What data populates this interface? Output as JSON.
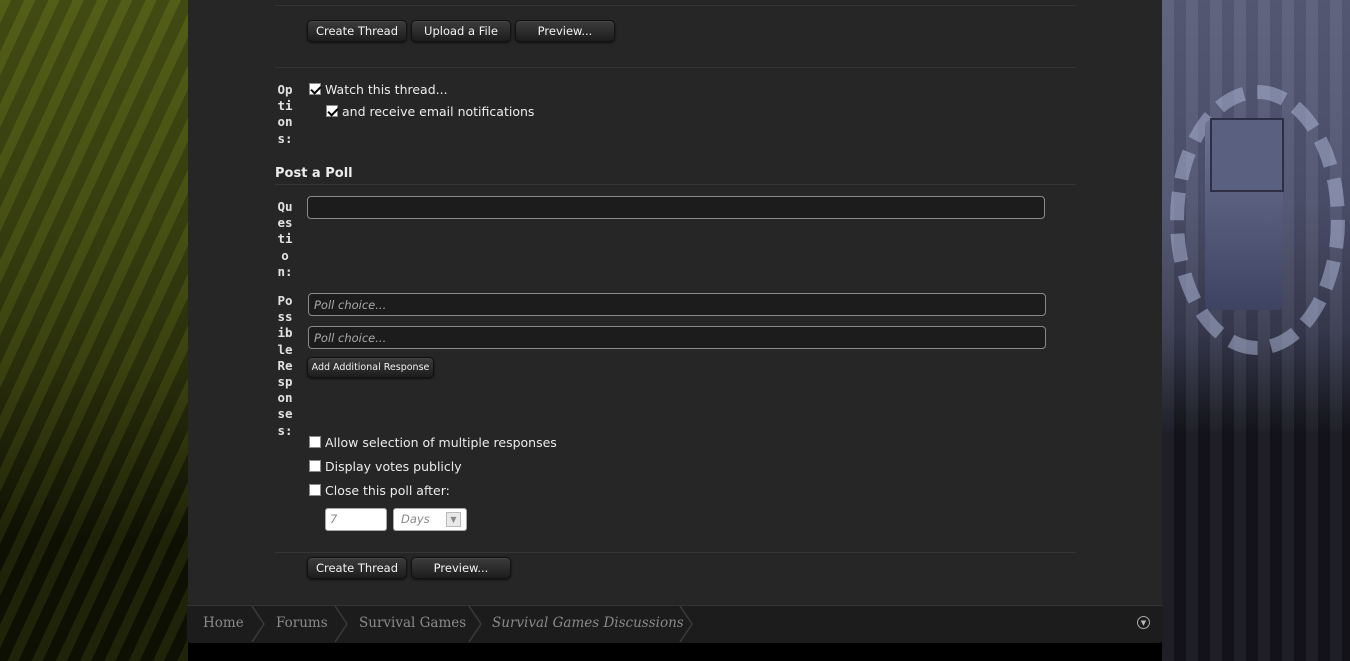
{
  "top_buttons": {
    "create_thread": "Create Thread",
    "upload_file": "Upload a File",
    "preview": "Preview..."
  },
  "options": {
    "label": "Options:",
    "watch_thread": "Watch this thread...",
    "receive_email": "and receive email notifications"
  },
  "poll": {
    "title": "Post a Poll",
    "question_label": "Question:",
    "question_value": "",
    "responses_label": "Possible Responses:",
    "choice_placeholder_1": "Poll choice...",
    "choice_placeholder_2": "Poll choice...",
    "add_response": "Add Additional Response",
    "allow_multiple": "Allow selection of multiple responses",
    "display_votes": "Display votes publicly",
    "close_after": "Close this poll after:",
    "close_value": "7",
    "close_unit": "Days"
  },
  "bottom_buttons": {
    "create_thread": "Create Thread",
    "preview": "Preview..."
  },
  "breadcrumb": {
    "items": [
      "Home",
      "Forums",
      "Survival Games",
      "Survival Games Discussions"
    ]
  },
  "colors": {
    "panel": "#262626",
    "footer": "#1c1c1c",
    "breadcrumb_text": "#8a8a8a"
  }
}
